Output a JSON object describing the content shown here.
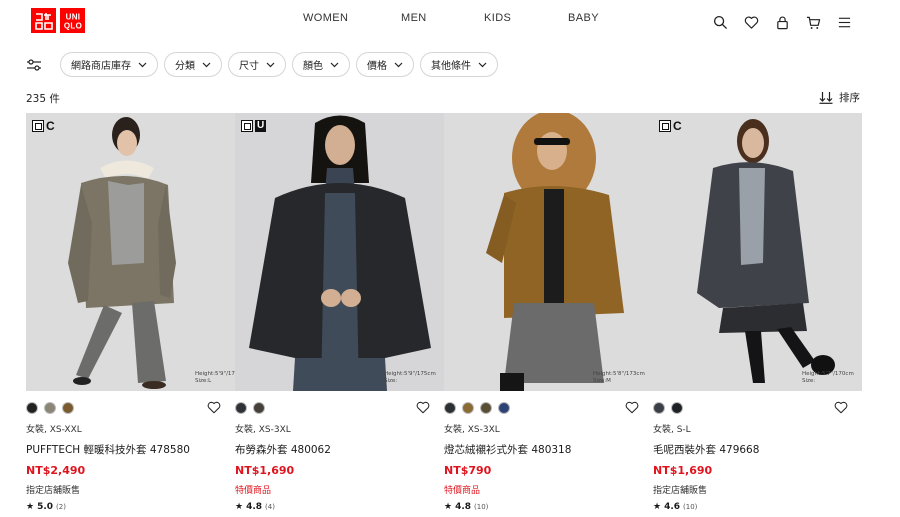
{
  "brand": {
    "logo_left": "ユニクロ",
    "logo_right": "UNIQLO",
    "color": "#ff0000"
  },
  "nav": [
    "WOMEN",
    "MEN",
    "KIDS",
    "BABY"
  ],
  "header_icons": [
    "search-icon",
    "heart-icon",
    "account-icon",
    "cart-icon",
    "menu-icon"
  ],
  "filters": {
    "icon": "filter-sliders-icon",
    "chips": [
      "網路商店庫存",
      "分類",
      "尺寸",
      "顏色",
      "價格",
      "其他條件"
    ]
  },
  "results": {
    "count": "235 件",
    "sort_label": "排序"
  },
  "products": [
    {
      "badge": "C",
      "badge_style": "plain",
      "model_size": "Height:5'9\"/175cm Size:L",
      "swatches": [
        "#222222",
        "#8b8577",
        "#7a5a2e"
      ],
      "meta": "女裝, XS-XXL",
      "name": "PUFFTECH 輕暖科技外套 478580",
      "price": "NT$2,490",
      "note": "指定店舖販售",
      "note_red": false,
      "rating": "5.0",
      "reviews": "(2)"
    },
    {
      "badge": "U",
      "badge_style": "box",
      "model_size": "Height:5'9\"/175cm Size:",
      "swatches": [
        "#2f3338",
        "#45403a"
      ],
      "meta": "女裝, XS-3XL",
      "name": "布勞森外套 480062",
      "price": "NT$1,690",
      "note": "特價商品",
      "note_red": true,
      "rating": "4.8",
      "reviews": "(4)"
    },
    {
      "badge": "",
      "badge_style": "none",
      "model_size": "Height:5'8\"/173cm Size:M",
      "swatches": [
        "#2c2f33",
        "#8a6a35",
        "#5a4f35",
        "#2d4377"
      ],
      "meta": "女裝, XS-3XL",
      "name": "燈芯絨襯衫式外套 480318",
      "price": "NT$790",
      "note": "特價商品",
      "note_red": true,
      "rating": "4.8",
      "reviews": "(10)"
    },
    {
      "badge": "C",
      "badge_style": "plain",
      "model_size": "Height:5'7\"/170cm Size:",
      "swatches": [
        "#3b4048",
        "#1e2126"
      ],
      "meta": "女裝, S-L",
      "name": "毛呢西裝外套 479668",
      "price": "NT$1,690",
      "note": "指定店舖販售",
      "note_red": false,
      "rating": "4.6",
      "reviews": "(10)"
    }
  ]
}
